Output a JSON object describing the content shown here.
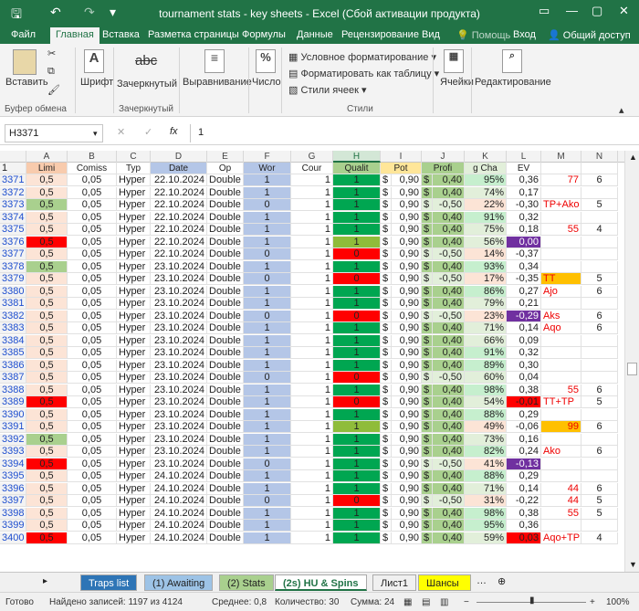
{
  "title": "tournament stats - key sheets - Excel (Сбой активации продукта)",
  "tabs": [
    "Файл",
    "Главная",
    "Вставка",
    "Разметка страницы",
    "Формулы",
    "Данные",
    "Рецензирование",
    "Вид",
    "Помощь",
    "Вход",
    "Общий доступ"
  ],
  "ribbon": {
    "paste": "Вставить",
    "clipboard": "Буфер обмена",
    "font": "Шрифт",
    "strike_icon": "abc",
    "strike": "Зачеркнутый",
    "strike_group": "Зачеркнутый",
    "align": "Выравнивание",
    "number": "Число",
    "number_icon": "%",
    "cond": "Условное форматирование",
    "table": "Форматировать как таблицу",
    "styles_btn": "Стили ячеек",
    "styles": "Стили",
    "cells": "Ячейки",
    "edit": "Редактирование"
  },
  "namebox": "H3371",
  "formula": "1",
  "colors": {
    "accent": "#217346",
    "green": "#00a651",
    "lightgreen": "#a9d08e",
    "red": "#ff0000",
    "blue": "#b4c6e7",
    "orange": "#ffc000",
    "purple": "#7030a0",
    "yellow": "#ffff00",
    "salmon": "#f8cbad"
  },
  "columns": [
    "A",
    "B",
    "C",
    "D",
    "E",
    "F",
    "G",
    "H",
    "I",
    "J",
    "K",
    "L",
    "M",
    "N"
  ],
  "headers": [
    "1",
    "Limi",
    "Comiss",
    "Typ",
    "Date",
    "Op",
    "Wor",
    "Cour",
    "Qualit",
    "Pot",
    "Profi",
    "g Cha",
    "EV",
    "",
    ""
  ],
  "rows": [
    [
      "3371",
      "0,5",
      "0,05",
      "Hyper",
      "22.10.2024",
      "Double",
      "1",
      "1",
      "1",
      "$",
      "0,90",
      "$",
      "0,40",
      "95%",
      "0,36",
      "77",
      "6"
    ],
    [
      "3372",
      "0,5",
      "0,05",
      "Hyper",
      "22.10.2024",
      "Double",
      "1",
      "1",
      "1",
      "$",
      "0,90",
      "$",
      "0,40",
      "74%",
      "0,17",
      "",
      ""
    ],
    [
      "3373",
      "0,5",
      "0,05",
      "Hyper",
      "22.10.2024",
      "Double",
      "0",
      "1",
      "1",
      "$",
      "0,90",
      "$",
      "-0,50",
      "22%",
      "-0,30",
      "TP+Ako",
      "5"
    ],
    [
      "3374",
      "0,5",
      "0,05",
      "Hyper",
      "22.10.2024",
      "Double",
      "1",
      "1",
      "1",
      "$",
      "0,90",
      "$",
      "0,40",
      "91%",
      "0,32",
      "",
      ""
    ],
    [
      "3375",
      "0,5",
      "0,05",
      "Hyper",
      "22.10.2024",
      "Double",
      "1",
      "1",
      "1",
      "$",
      "0,90",
      "$",
      "0,40",
      "75%",
      "0,18",
      "55",
      "4"
    ],
    [
      "3376",
      "0,5",
      "0,05",
      "Hyper",
      "22.10.2024",
      "Double",
      "1",
      "1",
      "1",
      "$",
      "0,90",
      "$",
      "0,40",
      "56%",
      "0,00",
      "",
      ""
    ],
    [
      "3377",
      "0,5",
      "0,05",
      "Hyper",
      "22.10.2024",
      "Double",
      "0",
      "1",
      "0",
      "$",
      "0,90",
      "$",
      "-0,50",
      "14%",
      "-0,37",
      "",
      ""
    ],
    [
      "3378",
      "0,5",
      "0,05",
      "Hyper",
      "23.10.2024",
      "Double",
      "1",
      "1",
      "1",
      "$",
      "0,90",
      "$",
      "0,40",
      "93%",
      "0,34",
      "",
      ""
    ],
    [
      "3379",
      "0,5",
      "0,05",
      "Hyper",
      "23.10.2024",
      "Double",
      "0",
      "1",
      "0",
      "$",
      "0,90",
      "$",
      "-0,50",
      "17%",
      "-0,35",
      "TT",
      "5"
    ],
    [
      "3380",
      "0,5",
      "0,05",
      "Hyper",
      "23.10.2024",
      "Double",
      "1",
      "1",
      "1",
      "$",
      "0,90",
      "$",
      "0,40",
      "86%",
      "0,27",
      "Ajo",
      "6"
    ],
    [
      "3381",
      "0,5",
      "0,05",
      "Hyper",
      "23.10.2024",
      "Double",
      "1",
      "1",
      "1",
      "$",
      "0,90",
      "$",
      "0,40",
      "79%",
      "0,21",
      "",
      ""
    ],
    [
      "3382",
      "0,5",
      "0,05",
      "Hyper",
      "23.10.2024",
      "Double",
      "0",
      "1",
      "0",
      "$",
      "0,90",
      "$",
      "-0,50",
      "23%",
      "-0,29",
      "Aks",
      "6"
    ],
    [
      "3383",
      "0,5",
      "0,05",
      "Hyper",
      "23.10.2024",
      "Double",
      "1",
      "1",
      "1",
      "$",
      "0,90",
      "$",
      "0,40",
      "71%",
      "0,14",
      "Aqo",
      "6"
    ],
    [
      "3384",
      "0,5",
      "0,05",
      "Hyper",
      "23.10.2024",
      "Double",
      "1",
      "1",
      "1",
      "$",
      "0,90",
      "$",
      "0,40",
      "66%",
      "0,09",
      "",
      ""
    ],
    [
      "3385",
      "0,5",
      "0,05",
      "Hyper",
      "23.10.2024",
      "Double",
      "1",
      "1",
      "1",
      "$",
      "0,90",
      "$",
      "0,40",
      "91%",
      "0,32",
      "",
      ""
    ],
    [
      "3386",
      "0,5",
      "0,05",
      "Hyper",
      "23.10.2024",
      "Double",
      "1",
      "1",
      "1",
      "$",
      "0,90",
      "$",
      "0,40",
      "89%",
      "0,30",
      "",
      ""
    ],
    [
      "3387",
      "0,5",
      "0,05",
      "Hyper",
      "23.10.2024",
      "Double",
      "0",
      "1",
      "0",
      "$",
      "0,90",
      "$",
      "-0,50",
      "60%",
      "0,04",
      "",
      ""
    ],
    [
      "3388",
      "0,5",
      "0,05",
      "Hyper",
      "23.10.2024",
      "Double",
      "1",
      "1",
      "1",
      "$",
      "0,90",
      "$",
      "0,40",
      "98%",
      "0,38",
      "55",
      "6"
    ],
    [
      "3389",
      "0,5",
      "0,05",
      "Hyper",
      "23.10.2024",
      "Double",
      "1",
      "1",
      "0",
      "$",
      "0,90",
      "$",
      "0,40",
      "54%",
      "-0,01",
      "TT+TP",
      "5"
    ],
    [
      "3390",
      "0,5",
      "0,05",
      "Hyper",
      "23.10.2024",
      "Double",
      "1",
      "1",
      "1",
      "$",
      "0,90",
      "$",
      "0,40",
      "88%",
      "0,29",
      "",
      ""
    ],
    [
      "3391",
      "0,5",
      "0,05",
      "Hyper",
      "23.10.2024",
      "Double",
      "1",
      "1",
      "1",
      "$",
      "0,90",
      "$",
      "0,40",
      "49%",
      "-0,06",
      "99",
      "6"
    ],
    [
      "3392",
      "0,5",
      "0,05",
      "Hyper",
      "23.10.2024",
      "Double",
      "1",
      "1",
      "1",
      "$",
      "0,90",
      "$",
      "0,40",
      "73%",
      "0,16",
      "",
      ""
    ],
    [
      "3393",
      "0,5",
      "0,05",
      "Hyper",
      "23.10.2024",
      "Double",
      "1",
      "1",
      "1",
      "$",
      "0,90",
      "$",
      "0,40",
      "82%",
      "0,24",
      "Ako",
      "6"
    ],
    [
      "3394",
      "0,5",
      "0,05",
      "Hyper",
      "23.10.2024",
      "Double",
      "0",
      "1",
      "1",
      "$",
      "0,90",
      "$",
      "-0,50",
      "41%",
      "-0,13",
      "",
      ""
    ],
    [
      "3395",
      "0,5",
      "0,05",
      "Hyper",
      "24.10.2024",
      "Double",
      "1",
      "1",
      "1",
      "$",
      "0,90",
      "$",
      "0,40",
      "88%",
      "0,29",
      "",
      ""
    ],
    [
      "3396",
      "0,5",
      "0,05",
      "Hyper",
      "24.10.2024",
      "Double",
      "1",
      "1",
      "1",
      "$",
      "0,90",
      "$",
      "0,40",
      "71%",
      "0,14",
      "44",
      "6"
    ],
    [
      "3397",
      "0,5",
      "0,05",
      "Hyper",
      "24.10.2024",
      "Double",
      "0",
      "1",
      "0",
      "$",
      "0,90",
      "$",
      "-0,50",
      "31%",
      "-0,22",
      "44",
      "5"
    ],
    [
      "3398",
      "0,5",
      "0,05",
      "Hyper",
      "24.10.2024",
      "Double",
      "1",
      "1",
      "1",
      "$",
      "0,90",
      "$",
      "0,40",
      "98%",
      "0,38",
      "55",
      "5"
    ],
    [
      "3399",
      "0,5",
      "0,05",
      "Hyper",
      "24.10.2024",
      "Double",
      "1",
      "1",
      "1",
      "$",
      "0,90",
      "$",
      "0,40",
      "95%",
      "0,36",
      "",
      ""
    ],
    [
      "3400",
      "0,5",
      "0,05",
      "Hyper",
      "24.10.2024",
      "Double",
      "1",
      "1",
      "1",
      "$",
      "0,90",
      "$",
      "0,40",
      "59%",
      "0,03",
      "Aqo+TP",
      "4"
    ]
  ],
  "sheets": [
    "Traps list",
    "(1) Awaiting",
    "(2) Stats",
    "(2s) HU & Spins",
    "Лист1",
    "Шансы н"
  ],
  "status": {
    "ready": "Готово",
    "found": "Найдено записей: 1197 из 4124",
    "avg": "Среднее: 0,8",
    "count": "Количество: 30",
    "sum": "Сумма: 24",
    "zoom": "100%"
  }
}
